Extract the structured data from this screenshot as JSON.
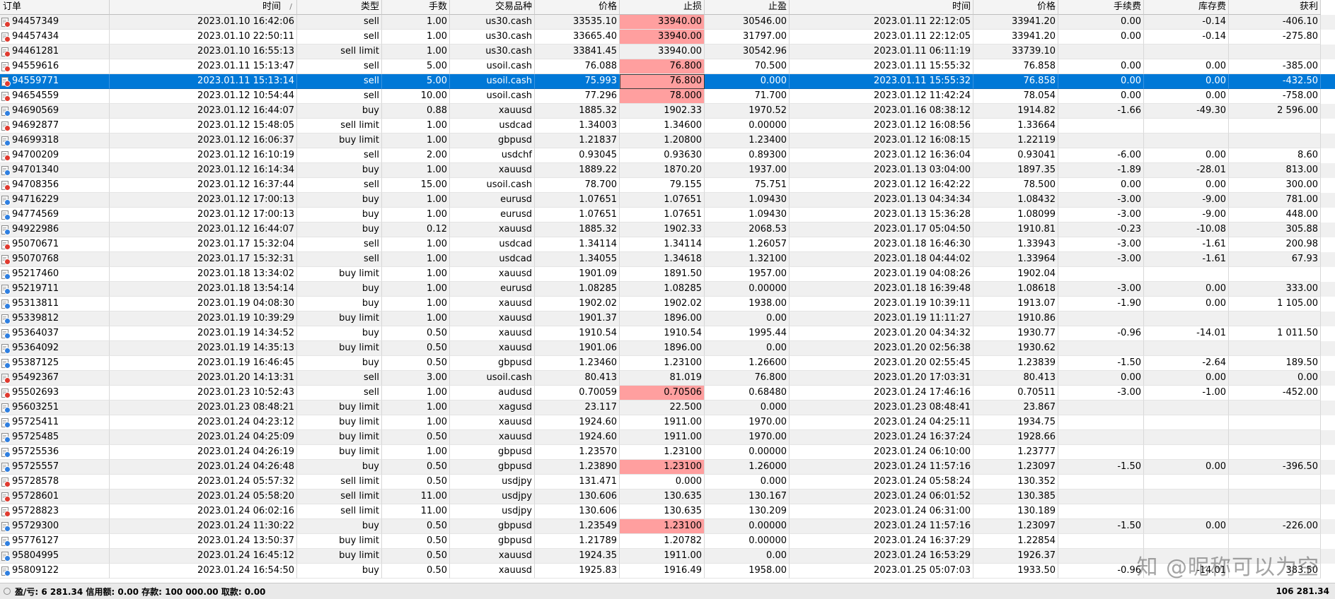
{
  "columns": {
    "order": "订单",
    "time": "时间",
    "type": "类型",
    "volume": "手数",
    "symbol": "交易品种",
    "price": "价格",
    "sl": "止损",
    "tp": "止盈",
    "close_time": "时间",
    "close_price": "价格",
    "commission": "手续费",
    "swap": "库存费",
    "profit": "获利"
  },
  "sort_indicator": "/",
  "selected_order": "94559771",
  "colors": {
    "selection": "#0078d7",
    "sl_hit": "#ff9f9f",
    "sell_badge": "#e03a2f",
    "buy_badge": "#2f7fe0"
  },
  "icons": {
    "order_row": "order-doc-icon",
    "status": "status-circle-icon"
  },
  "rows": [
    {
      "order": "94457349",
      "time": "2023.01.10 16:42:06",
      "type": "sell",
      "volume": "1.00",
      "symbol": "us30.cash",
      "price": "33535.10",
      "sl": "33940.00",
      "tp": "30546.00",
      "close_time": "2023.01.11 22:12:05",
      "close_price": "33941.20",
      "commission": "0.00",
      "swap": "-0.14",
      "profit": "-406.10",
      "sl_hit": true
    },
    {
      "order": "94457434",
      "time": "2023.01.10 22:50:11",
      "type": "sell",
      "volume": "1.00",
      "symbol": "us30.cash",
      "price": "33665.40",
      "sl": "33940.00",
      "tp": "31797.00",
      "close_time": "2023.01.11 22:12:05",
      "close_price": "33941.20",
      "commission": "0.00",
      "swap": "-0.14",
      "profit": "-275.80",
      "sl_hit": true
    },
    {
      "order": "94461281",
      "time": "2023.01.10 16:55:13",
      "type": "sell limit",
      "volume": "1.00",
      "symbol": "us30.cash",
      "price": "33841.45",
      "sl": "33940.00",
      "tp": "30542.96",
      "close_time": "2023.01.11 06:11:19",
      "close_price": "33739.10",
      "commission": "",
      "swap": "",
      "profit": ""
    },
    {
      "order": "94559616",
      "time": "2023.01.11 15:13:47",
      "type": "sell",
      "volume": "5.00",
      "symbol": "usoil.cash",
      "price": "76.088",
      "sl": "76.800",
      "tp": "70.500",
      "close_time": "2023.01.11 15:55:32",
      "close_price": "76.858",
      "commission": "0.00",
      "swap": "0.00",
      "profit": "-385.00",
      "sl_hit": true
    },
    {
      "order": "94559771",
      "time": "2023.01.11 15:13:14",
      "type": "sell",
      "volume": "5.00",
      "symbol": "usoil.cash",
      "price": "75.993",
      "sl": "76.800",
      "tp": "0.000",
      "close_time": "2023.01.11 15:55:32",
      "close_price": "76.858",
      "commission": "0.00",
      "swap": "0.00",
      "profit": "-432.50",
      "sl_hit": true
    },
    {
      "order": "94654559",
      "time": "2023.01.12 10:54:44",
      "type": "sell",
      "volume": "10.00",
      "symbol": "usoil.cash",
      "price": "77.296",
      "sl": "78.000",
      "tp": "71.700",
      "close_time": "2023.01.12 11:42:24",
      "close_price": "78.054",
      "commission": "0.00",
      "swap": "0.00",
      "profit": "-758.00",
      "sl_hit": true
    },
    {
      "order": "94690569",
      "time": "2023.01.12 16:44:07",
      "type": "buy",
      "volume": "0.88",
      "symbol": "xauusd",
      "price": "1885.32",
      "sl": "1902.33",
      "tp": "1970.52",
      "close_time": "2023.01.16 08:38:12",
      "close_price": "1914.82",
      "commission": "-1.66",
      "swap": "-49.30",
      "profit": "2 596.00"
    },
    {
      "order": "94692877",
      "time": "2023.01.12 15:48:05",
      "type": "sell limit",
      "volume": "1.00",
      "symbol": "usdcad",
      "price": "1.34003",
      "sl": "1.34600",
      "tp": "0.00000",
      "close_time": "2023.01.12 16:08:56",
      "close_price": "1.33664",
      "commission": "",
      "swap": "",
      "profit": ""
    },
    {
      "order": "94699318",
      "time": "2023.01.12 16:06:37",
      "type": "buy limit",
      "volume": "1.00",
      "symbol": "gbpusd",
      "price": "1.21837",
      "sl": "1.20800",
      "tp": "1.23400",
      "close_time": "2023.01.12 16:08:15",
      "close_price": "1.22119",
      "commission": "",
      "swap": "",
      "profit": ""
    },
    {
      "order": "94700209",
      "time": "2023.01.12 16:10:19",
      "type": "sell",
      "volume": "2.00",
      "symbol": "usdchf",
      "price": "0.93045",
      "sl": "0.93630",
      "tp": "0.89300",
      "close_time": "2023.01.12 16:36:04",
      "close_price": "0.93041",
      "commission": "-6.00",
      "swap": "0.00",
      "profit": "8.60"
    },
    {
      "order": "94701340",
      "time": "2023.01.12 16:14:34",
      "type": "buy",
      "volume": "1.00",
      "symbol": "xauusd",
      "price": "1889.22",
      "sl": "1870.20",
      "tp": "1937.00",
      "close_time": "2023.01.13 03:04:00",
      "close_price": "1897.35",
      "commission": "-1.89",
      "swap": "-28.01",
      "profit": "813.00"
    },
    {
      "order": "94708356",
      "time": "2023.01.12 16:37:44",
      "type": "sell",
      "volume": "15.00",
      "symbol": "usoil.cash",
      "price": "78.700",
      "sl": "79.155",
      "tp": "75.751",
      "close_time": "2023.01.12 16:42:22",
      "close_price": "78.500",
      "commission": "0.00",
      "swap": "0.00",
      "profit": "300.00"
    },
    {
      "order": "94716229",
      "time": "2023.01.12 17:00:13",
      "type": "buy",
      "volume": "1.00",
      "symbol": "eurusd",
      "price": "1.07651",
      "sl": "1.07651",
      "tp": "1.09430",
      "close_time": "2023.01.13 04:34:34",
      "close_price": "1.08432",
      "commission": "-3.00",
      "swap": "-9.00",
      "profit": "781.00"
    },
    {
      "order": "94774569",
      "time": "2023.01.12 17:00:13",
      "type": "buy",
      "volume": "1.00",
      "symbol": "eurusd",
      "price": "1.07651",
      "sl": "1.07651",
      "tp": "1.09430",
      "close_time": "2023.01.13 15:36:28",
      "close_price": "1.08099",
      "commission": "-3.00",
      "swap": "-9.00",
      "profit": "448.00"
    },
    {
      "order": "94922986",
      "time": "2023.01.12 16:44:07",
      "type": "buy",
      "volume": "0.12",
      "symbol": "xauusd",
      "price": "1885.32",
      "sl": "1902.33",
      "tp": "2068.53",
      "close_time": "2023.01.17 05:04:50",
      "close_price": "1910.81",
      "commission": "-0.23",
      "swap": "-10.08",
      "profit": "305.88"
    },
    {
      "order": "95070671",
      "time": "2023.01.17 15:32:04",
      "type": "sell",
      "volume": "1.00",
      "symbol": "usdcad",
      "price": "1.34114",
      "sl": "1.34114",
      "tp": "1.26057",
      "close_time": "2023.01.18 16:46:30",
      "close_price": "1.33943",
      "commission": "-3.00",
      "swap": "-1.61",
      "profit": "200.98"
    },
    {
      "order": "95070768",
      "time": "2023.01.17 15:32:31",
      "type": "sell",
      "volume": "1.00",
      "symbol": "usdcad",
      "price": "1.34055",
      "sl": "1.34618",
      "tp": "1.32100",
      "close_time": "2023.01.18 04:44:02",
      "close_price": "1.33964",
      "commission": "-3.00",
      "swap": "-1.61",
      "profit": "67.93"
    },
    {
      "order": "95217460",
      "time": "2023.01.18 13:34:02",
      "type": "buy limit",
      "volume": "1.00",
      "symbol": "xauusd",
      "price": "1901.09",
      "sl": "1891.50",
      "tp": "1957.00",
      "close_time": "2023.01.19 04:08:26",
      "close_price": "1902.04",
      "commission": "",
      "swap": "",
      "profit": ""
    },
    {
      "order": "95219711",
      "time": "2023.01.18 13:54:14",
      "type": "buy",
      "volume": "1.00",
      "symbol": "eurusd",
      "price": "1.08285",
      "sl": "1.08285",
      "tp": "0.00000",
      "close_time": "2023.01.18 16:39:48",
      "close_price": "1.08618",
      "commission": "-3.00",
      "swap": "0.00",
      "profit": "333.00"
    },
    {
      "order": "95313811",
      "time": "2023.01.19 04:08:30",
      "type": "buy",
      "volume": "1.00",
      "symbol": "xauusd",
      "price": "1902.02",
      "sl": "1902.02",
      "tp": "1938.00",
      "close_time": "2023.01.19 10:39:11",
      "close_price": "1913.07",
      "commission": "-1.90",
      "swap": "0.00",
      "profit": "1 105.00"
    },
    {
      "order": "95339812",
      "time": "2023.01.19 10:39:29",
      "type": "buy limit",
      "volume": "1.00",
      "symbol": "xauusd",
      "price": "1901.37",
      "sl": "1896.00",
      "tp": "0.00",
      "close_time": "2023.01.19 11:11:27",
      "close_price": "1910.86",
      "commission": "",
      "swap": "",
      "profit": ""
    },
    {
      "order": "95364037",
      "time": "2023.01.19 14:34:52",
      "type": "buy",
      "volume": "0.50",
      "symbol": "xauusd",
      "price": "1910.54",
      "sl": "1910.54",
      "tp": "1995.44",
      "close_time": "2023.01.20 04:34:32",
      "close_price": "1930.77",
      "commission": "-0.96",
      "swap": "-14.01",
      "profit": "1 011.50"
    },
    {
      "order": "95364092",
      "time": "2023.01.19 14:35:13",
      "type": "buy limit",
      "volume": "0.50",
      "symbol": "xauusd",
      "price": "1901.06",
      "sl": "1896.00",
      "tp": "0.00",
      "close_time": "2023.01.20 02:56:38",
      "close_price": "1930.62",
      "commission": "",
      "swap": "",
      "profit": ""
    },
    {
      "order": "95387125",
      "time": "2023.01.19 16:46:45",
      "type": "buy",
      "volume": "0.50",
      "symbol": "gbpusd",
      "price": "1.23460",
      "sl": "1.23100",
      "tp": "1.26600",
      "close_time": "2023.01.20 02:55:45",
      "close_price": "1.23839",
      "commission": "-1.50",
      "swap": "-2.64",
      "profit": "189.50"
    },
    {
      "order": "95492367",
      "time": "2023.01.20 14:13:31",
      "type": "sell",
      "volume": "3.00",
      "symbol": "usoil.cash",
      "price": "80.413",
      "sl": "81.019",
      "tp": "76.800",
      "close_time": "2023.01.20 17:03:31",
      "close_price": "80.413",
      "commission": "0.00",
      "swap": "0.00",
      "profit": "0.00"
    },
    {
      "order": "95502693",
      "time": "2023.01.23 10:52:43",
      "type": "sell",
      "volume": "1.00",
      "symbol": "audusd",
      "price": "0.70059",
      "sl": "0.70506",
      "tp": "0.68480",
      "close_time": "2023.01.24 17:46:16",
      "close_price": "0.70511",
      "commission": "-3.00",
      "swap": "-1.00",
      "profit": "-452.00",
      "sl_hit": true
    },
    {
      "order": "95603251",
      "time": "2023.01.23 08:48:21",
      "type": "buy limit",
      "volume": "1.00",
      "symbol": "xagusd",
      "price": "23.117",
      "sl": "22.500",
      "tp": "0.000",
      "close_time": "2023.01.23 08:48:41",
      "close_price": "23.867",
      "commission": "",
      "swap": "",
      "profit": ""
    },
    {
      "order": "95725411",
      "time": "2023.01.24 04:23:12",
      "type": "buy limit",
      "volume": "1.00",
      "symbol": "xauusd",
      "price": "1924.60",
      "sl": "1911.00",
      "tp": "1970.00",
      "close_time": "2023.01.24 04:25:11",
      "close_price": "1934.75",
      "commission": "",
      "swap": "",
      "profit": ""
    },
    {
      "order": "95725485",
      "time": "2023.01.24 04:25:09",
      "type": "buy limit",
      "volume": "0.50",
      "symbol": "xauusd",
      "price": "1924.60",
      "sl": "1911.00",
      "tp": "1970.00",
      "close_time": "2023.01.24 16:37:24",
      "close_price": "1928.66",
      "commission": "",
      "swap": "",
      "profit": ""
    },
    {
      "order": "95725536",
      "time": "2023.01.24 04:26:19",
      "type": "buy limit",
      "volume": "1.00",
      "symbol": "gbpusd",
      "price": "1.23570",
      "sl": "1.23100",
      "tp": "0.00000",
      "close_time": "2023.01.24 06:10:00",
      "close_price": "1.23777",
      "commission": "",
      "swap": "",
      "profit": ""
    },
    {
      "order": "95725557",
      "time": "2023.01.24 04:26:48",
      "type": "buy",
      "volume": "0.50",
      "symbol": "gbpusd",
      "price": "1.23890",
      "sl": "1.23100",
      "tp": "1.26000",
      "close_time": "2023.01.24 11:57:16",
      "close_price": "1.23097",
      "commission": "-1.50",
      "swap": "0.00",
      "profit": "-396.50",
      "sl_hit": true
    },
    {
      "order": "95728578",
      "time": "2023.01.24 05:57:32",
      "type": "sell limit",
      "volume": "0.50",
      "symbol": "usdjpy",
      "price": "131.471",
      "sl": "0.000",
      "tp": "0.000",
      "close_time": "2023.01.24 05:58:24",
      "close_price": "130.352",
      "commission": "",
      "swap": "",
      "profit": ""
    },
    {
      "order": "95728601",
      "time": "2023.01.24 05:58:20",
      "type": "sell limit",
      "volume": "11.00",
      "symbol": "usdjpy",
      "price": "130.606",
      "sl": "130.635",
      "tp": "130.167",
      "close_time": "2023.01.24 06:01:52",
      "close_price": "130.385",
      "commission": "",
      "swap": "",
      "profit": ""
    },
    {
      "order": "95728823",
      "time": "2023.01.24 06:02:16",
      "type": "sell limit",
      "volume": "11.00",
      "symbol": "usdjpy",
      "price": "130.606",
      "sl": "130.635",
      "tp": "130.209",
      "close_time": "2023.01.24 06:31:00",
      "close_price": "130.189",
      "commission": "",
      "swap": "",
      "profit": ""
    },
    {
      "order": "95729300",
      "time": "2023.01.24 11:30:22",
      "type": "buy",
      "volume": "0.50",
      "symbol": "gbpusd",
      "price": "1.23549",
      "sl": "1.23100",
      "tp": "0.00000",
      "close_time": "2023.01.24 11:57:16",
      "close_price": "1.23097",
      "commission": "-1.50",
      "swap": "0.00",
      "profit": "-226.00",
      "sl_hit": true
    },
    {
      "order": "95776127",
      "time": "2023.01.24 13:50:37",
      "type": "buy limit",
      "volume": "0.50",
      "symbol": "gbpusd",
      "price": "1.21789",
      "sl": "1.20782",
      "tp": "0.00000",
      "close_time": "2023.01.24 16:37:29",
      "close_price": "1.22854",
      "commission": "",
      "swap": "",
      "profit": ""
    },
    {
      "order": "95804995",
      "time": "2023.01.24 16:45:12",
      "type": "buy limit",
      "volume": "0.50",
      "symbol": "xauusd",
      "price": "1924.35",
      "sl": "1911.00",
      "tp": "0.00",
      "close_time": "2023.01.24 16:53:29",
      "close_price": "1926.37",
      "commission": "",
      "swap": "",
      "profit": ""
    },
    {
      "order": "95809122",
      "time": "2023.01.24 16:54:50",
      "type": "buy",
      "volume": "0.50",
      "symbol": "xauusd",
      "price": "1925.83",
      "sl": "1916.49",
      "tp": "1958.00",
      "close_time": "2023.01.25 05:07:03",
      "close_price": "1933.50",
      "commission": "-0.96",
      "swap": "-14.01",
      "profit": "383.50"
    }
  ],
  "status": {
    "text": "盈/亏: 6 281.34  信用额: 0.00  存款: 100 000.00  取款: 0.00",
    "total": "106 281.34"
  },
  "watermark": "知 @昵称可以为空"
}
